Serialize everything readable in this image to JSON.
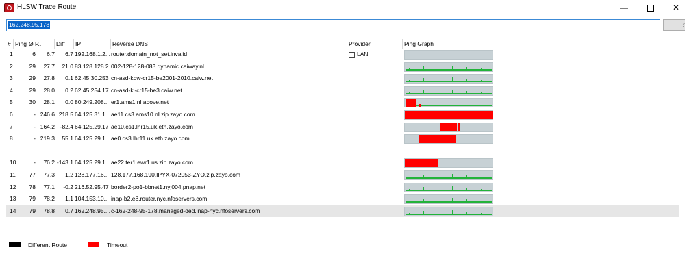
{
  "window": {
    "title": "HLSW Trace Route"
  },
  "controls": {
    "target": "162.248.95.178",
    "start_label": "S"
  },
  "columns": [
    "#",
    "Ping",
    "Ø P...",
    "Diff",
    "IP",
    "Reverse DNS",
    "Provider",
    "Ping Graph"
  ],
  "hops": [
    {
      "num": "1",
      "ping": "6",
      "avg": "6.7",
      "diff": "6.7",
      "ip": "192.168.1.2...",
      "dns": "router.domain_not_set.invalid",
      "provider": "LAN",
      "graph": "gray"
    },
    {
      "num": "2",
      "ping": "29",
      "avg": "27.7",
      "diff": "21.0",
      "ip": "83.128.128.2",
      "dns": "002-128-128-083.dynamic.caiway.nl",
      "provider": "",
      "graph": "green"
    },
    {
      "num": "3",
      "ping": "29",
      "avg": "27.8",
      "diff": "0.1",
      "ip": "62.45.30.253",
      "dns": "cn-asd-kbw-cr15-be2001-2010.caiw.net",
      "provider": "",
      "graph": "green"
    },
    {
      "num": "4",
      "ping": "29",
      "avg": "28.0",
      "diff": "0.2",
      "ip": "62.45.254.17",
      "dns": "cn-asd-kl-cr15-be3.caiw.net",
      "provider": "",
      "graph": "green"
    },
    {
      "num": "5",
      "ping": "30",
      "avg": "28.1",
      "diff": "0.0",
      "ip": "80.249.208...",
      "dns": "er1.ams1.nl.above.net",
      "provider": "",
      "graph": "partial-red"
    },
    {
      "num": "6",
      "ping": "-",
      "avg": "246.6",
      "diff": "218.5",
      "ip": "64.125.31.1...",
      "dns": "ae11.cs3.ams10.nl.zip.zayo.com",
      "provider": "",
      "graph": "red"
    },
    {
      "num": "7",
      "ping": "-",
      "avg": "164.2",
      "diff": "-82.4",
      "ip": "64.125.29.17",
      "dns": "ae10.cs1.lhr15.uk.eth.zayo.com",
      "provider": "",
      "graph": "red-end"
    },
    {
      "num": "8",
      "ping": "-",
      "avg": "219.3",
      "diff": "55.1",
      "ip": "64.125.29.1...",
      "dns": "ae0.cs3.lhr11.uk.eth.zayo.com",
      "provider": "",
      "graph": "red-mid"
    },
    {
      "num": "",
      "ping": "",
      "avg": "",
      "diff": "",
      "ip": "",
      "dns": "",
      "provider": "",
      "graph": "none"
    },
    {
      "num": "10",
      "ping": "-",
      "avg": "76.2",
      "diff": "-143.1",
      "ip": "64.125.29.1...",
      "dns": "ae22.ter1.ewr1.us.zip.zayo.com",
      "provider": "",
      "graph": "red-start"
    },
    {
      "num": "11",
      "ping": "77",
      "avg": "77.3",
      "diff": "1.2",
      "ip": "128.177.16...",
      "dns": "128.177.168.190.IPYX-072053-ZYO.zip.zayo.com",
      "provider": "",
      "graph": "green"
    },
    {
      "num": "12",
      "ping": "78",
      "avg": "77.1",
      "diff": "-0.2",
      "ip": "216.52.95.47",
      "dns": "border2-po1-bbnet1.nyj004.pnap.net",
      "provider": "",
      "graph": "green"
    },
    {
      "num": "13",
      "ping": "79",
      "avg": "78.2",
      "diff": "1.1",
      "ip": "104.153.10...",
      "dns": "inap-b2.e8.router.nyc.nfoservers.com",
      "provider": "",
      "graph": "green"
    },
    {
      "num": "14",
      "ping": "79",
      "avg": "78.8",
      "diff": "0.7",
      "ip": "162.248.95....",
      "dns": "c-162-248-95-178.managed-ded.inap-nyc.nfoservers.com",
      "provider": "",
      "graph": "green",
      "selected": true
    }
  ],
  "legend": {
    "different_route": "Different Route",
    "timeout": "Timeout"
  },
  "colors": {
    "timeout": "#ff0000",
    "ping_line": "#22b33a",
    "graph_bg": "#c7d1d5"
  }
}
